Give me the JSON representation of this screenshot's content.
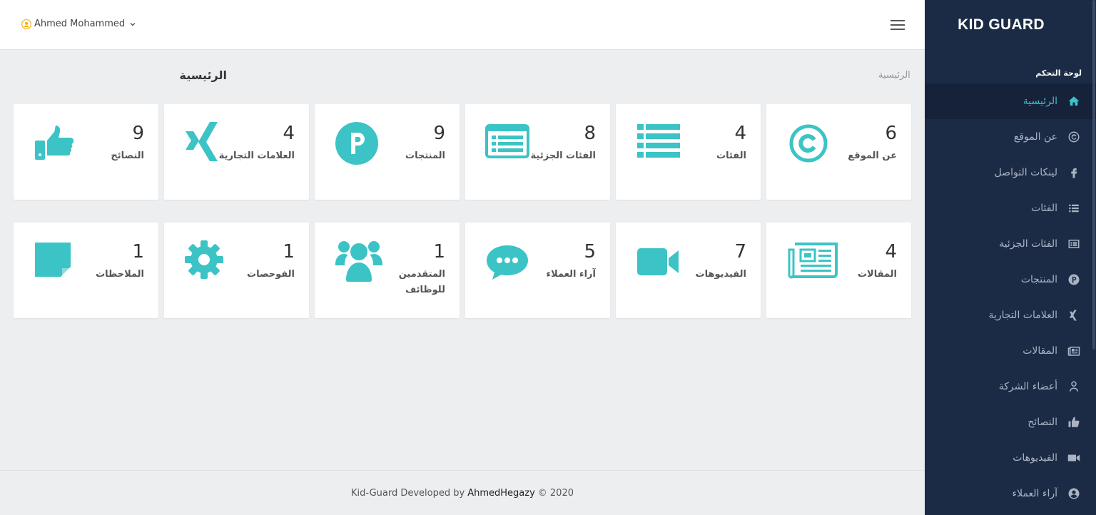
{
  "brand": "KID GUARD",
  "sidebar": {
    "header": "لوحة التحكم",
    "items": [
      {
        "label": "الرئيسية",
        "icon": "home-icon",
        "active": true
      },
      {
        "label": "عن الموقع",
        "icon": "copyright-icon"
      },
      {
        "label": "لينكات التواصل",
        "icon": "facebook-icon"
      },
      {
        "label": "الفئات",
        "icon": "list-icon"
      },
      {
        "label": "الفئات الجزئية",
        "icon": "list-alt-icon"
      },
      {
        "label": "المنتجات",
        "icon": "product-p-icon"
      },
      {
        "label": "العلامات التجارية",
        "icon": "xing-icon"
      },
      {
        "label": "المقالات",
        "icon": "newspaper-icon"
      },
      {
        "label": "أعضاء الشركة",
        "icon": "user-icon"
      },
      {
        "label": "النصائح",
        "icon": "thumbs-up-icon"
      },
      {
        "label": "الفيديوهات",
        "icon": "video-icon"
      },
      {
        "label": "آراء العملاء",
        "icon": "user-circle-icon"
      }
    ]
  },
  "topbar": {
    "user_name": "Ahmed Mohammed"
  },
  "page": {
    "title": "الرئيسية",
    "breadcrumb": "الرئيسية"
  },
  "cards": [
    {
      "count": "6",
      "label": "عن الموقع",
      "icon": "copyright-icon"
    },
    {
      "count": "4",
      "label": "الفئات",
      "icon": "list-icon"
    },
    {
      "count": "8",
      "label": "الفئات الجزئية",
      "icon": "list-alt-icon"
    },
    {
      "count": "9",
      "label": "المنتجات",
      "icon": "product-p-icon"
    },
    {
      "count": "4",
      "label": "العلامات التجارية",
      "icon": "xing-icon"
    },
    {
      "count": "9",
      "label": "النصائح",
      "icon": "thumbs-up-icon"
    },
    {
      "count": "4",
      "label": "المقالات",
      "icon": "newspaper-icon"
    },
    {
      "count": "7",
      "label": "الفيديوهات",
      "icon": "video-icon"
    },
    {
      "count": "5",
      "label": "آراء العملاء",
      "icon": "comment-icon"
    },
    {
      "count": "1",
      "label": "المتقدمين للوظائف",
      "icon": "users-icon"
    },
    {
      "count": "1",
      "label": "الفوحصات",
      "icon": "gear-icon"
    },
    {
      "count": "1",
      "label": "الملاحظات",
      "icon": "sticky-note-icon"
    }
  ],
  "footer": {
    "prefix": "Kid-Guard Developed by",
    "author": "AhmedHegazy",
    "suffix": "© 2020"
  },
  "colors": {
    "accent": "#3cc3c6",
    "sidebar_bg": "#1c2b45",
    "sidebar_text": "#a9b3c4"
  }
}
